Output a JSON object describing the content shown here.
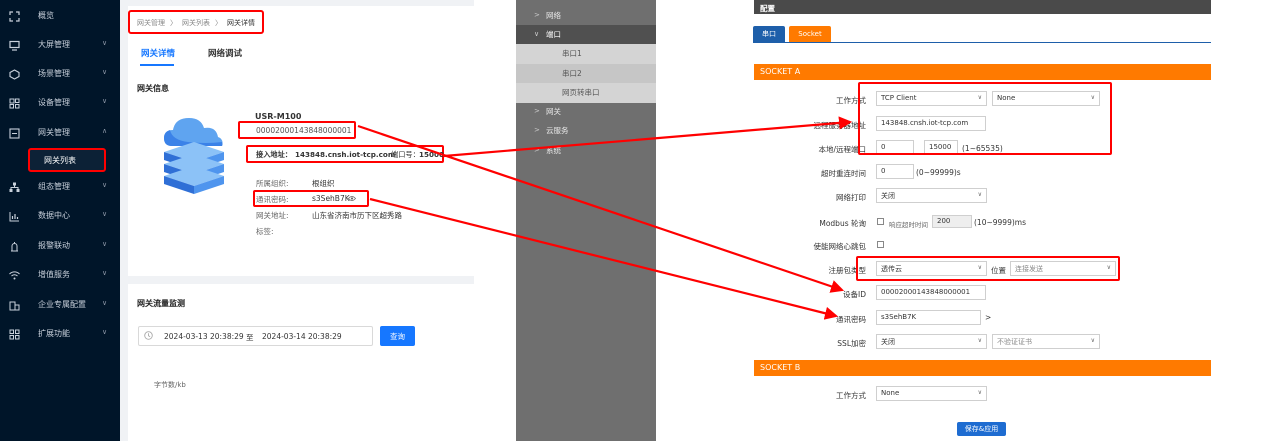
{
  "left": {
    "sidebar": {
      "items": [
        {
          "label": "概览",
          "icon": "overview-icon"
        },
        {
          "label": "大屏管理",
          "icon": "monitor-icon"
        },
        {
          "label": "场景管理",
          "icon": "scene-icon"
        },
        {
          "label": "设备管理",
          "icon": "device-icon"
        },
        {
          "label": "网关管理",
          "icon": "gateway-icon"
        },
        {
          "label": "网关列表"
        },
        {
          "label": "组态管理",
          "icon": "configuration-icon"
        },
        {
          "label": "数据中心",
          "icon": "chart-icon"
        },
        {
          "label": "报警联动",
          "icon": "alarm-icon"
        },
        {
          "label": "增值服务",
          "icon": "wifi-icon"
        },
        {
          "label": "企业专属配置",
          "icon": "enterprise-icon"
        },
        {
          "label": "扩展功能",
          "icon": "grid-icon"
        }
      ]
    },
    "breadcrumb": {
      "a": "网关管理",
      "b": "网关列表",
      "c": "网关详情",
      "sep": "〉"
    },
    "tabs": {
      "detail": "网关详情",
      "debug": "网络调试"
    },
    "gateway_info_title": "网关信息",
    "model": "USR-M100",
    "sn": "00002000143848000001",
    "access": {
      "addr_label": "接入地址：",
      "addr": "143848.cnsh.iot-tcp.com",
      "port_label": "端口号：",
      "port": "15000"
    },
    "org_label": "所属组织:",
    "org_value": "根组织",
    "pwd_label": "通讯密码:",
    "pwd_value": "s3SehB7K",
    "addr_label": "网关地址:",
    "addr_value": "山东省济南市历下区超秀路",
    "tag_label": "标签:",
    "traffic_title": "网关流量监测",
    "date_from": "2024-03-13 20:38:29",
    "date_to_sep": "至",
    "date_to": "2024-03-14 20:38:29",
    "query_btn": "查询",
    "unit": "字节数/kb",
    "colors": {
      "accent": "#1677ff",
      "sidebar": "#001529",
      "highlight": "#ff0000"
    }
  },
  "right": {
    "nav": [
      {
        "label": "网络",
        "arrow": ">"
      },
      {
        "label": "端口",
        "arrow": "∨"
      },
      {
        "label": "串口1"
      },
      {
        "label": "串口2"
      },
      {
        "label": "网页转串口"
      },
      {
        "label": "网关",
        "arrow": ">"
      },
      {
        "label": "云服务",
        "arrow": ">"
      },
      {
        "label": "系统",
        "arrow": ">"
      }
    ],
    "config_title": "配置",
    "tab_serial": "串口",
    "tab_socket": "Socket",
    "socket_a": "SOCKET A",
    "socket_b": "SOCKET B",
    "work_mode_label": "工作方式",
    "work_mode": "TCP Client",
    "work_mode_sub": "None",
    "remote_label": "远程服务器地址",
    "remote": "143848.cnsh.iot-tcp.com",
    "port_label": "本地/远程端口",
    "local_port": "0",
    "remote_port": "15000",
    "port_range": "(1~65535)",
    "timeout_label": "超时重连时间",
    "timeout": "0",
    "timeout_unit": "(0~99999)s",
    "net_print_label": "网络打印",
    "net_print": "关闭",
    "modbus_label": "Modbus 轮询",
    "modbus_hint": "响应超时时间",
    "modbus_value": "200",
    "modbus_unit": "(10~9999)ms",
    "heartbeat_label": "使能网络心跳包",
    "reg_label": "注册包类型",
    "reg_value": "透传云",
    "pos_label": "位置",
    "pos_value": "连接发送",
    "device_id_label": "设备ID",
    "device_id": "00002000143848000001",
    "comm_pwd_label": "通讯密码",
    "comm_pwd": "s3SehB7K",
    "comm_pwd_suffix": ">",
    "ssl_label": "SSL加密",
    "ssl_value": "关闭",
    "ssl_cert": "不验证证书",
    "save_btn": "保存&应用",
    "colors": {
      "orange": "#ff7a00",
      "blue": "#1e5faa"
    }
  }
}
